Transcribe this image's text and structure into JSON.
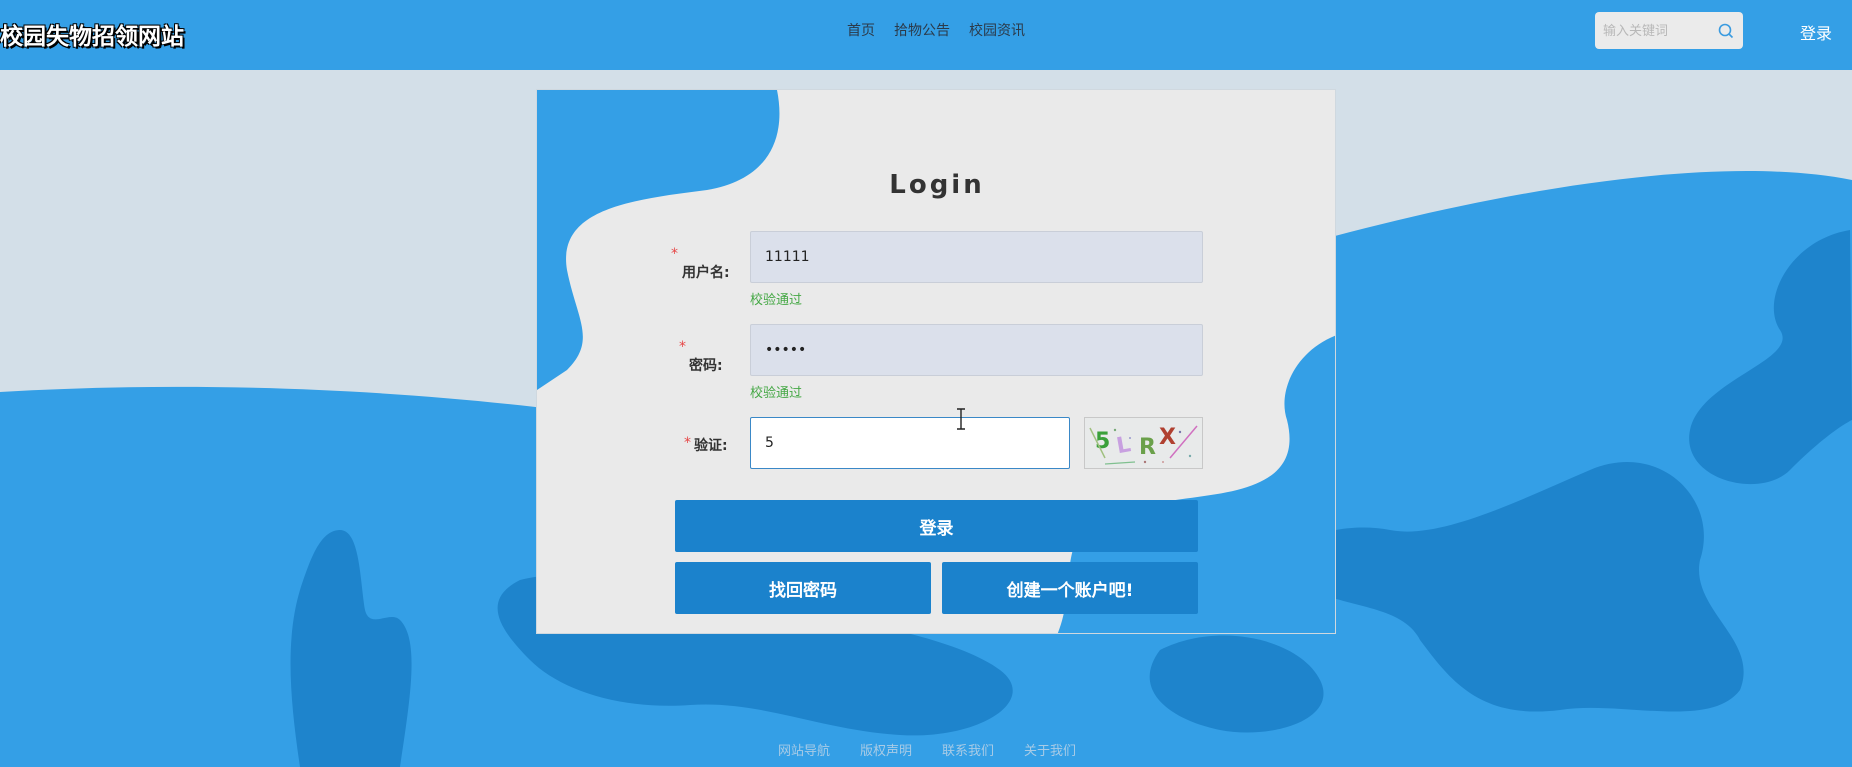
{
  "header": {
    "brand": "校园失物招领网站",
    "nav": [
      "首页",
      "拾物公告",
      "校园资讯"
    ],
    "search_placeholder": "输入关键词",
    "login_link": "登录"
  },
  "login": {
    "title": "Login",
    "username_label": "用户名:",
    "username_value": "11111",
    "username_status": "校验通过",
    "password_label": "密码:",
    "password_value": "•••••",
    "password_status": "校验通过",
    "captcha_label": "验证:",
    "captcha_value": "5",
    "captcha_text": "5LRX",
    "required_mark": "*",
    "login_button": "登录",
    "find_password_button": "找回密码",
    "create_account_button": "创建一个账户吧!"
  },
  "footer": {
    "links": [
      "网站导航",
      "版权声明",
      "联系我们",
      "关于我们"
    ]
  },
  "colors": {
    "header_bg": "#349fe6",
    "primary_button": "#1b82cc",
    "background": "#d3dfe8",
    "wave": "#349fe6",
    "wave_dark": "#1e84cc",
    "valid_text": "#45a845",
    "required_mark": "#e64646"
  },
  "icons": [
    "search-icon",
    "text-cursor-icon"
  ]
}
